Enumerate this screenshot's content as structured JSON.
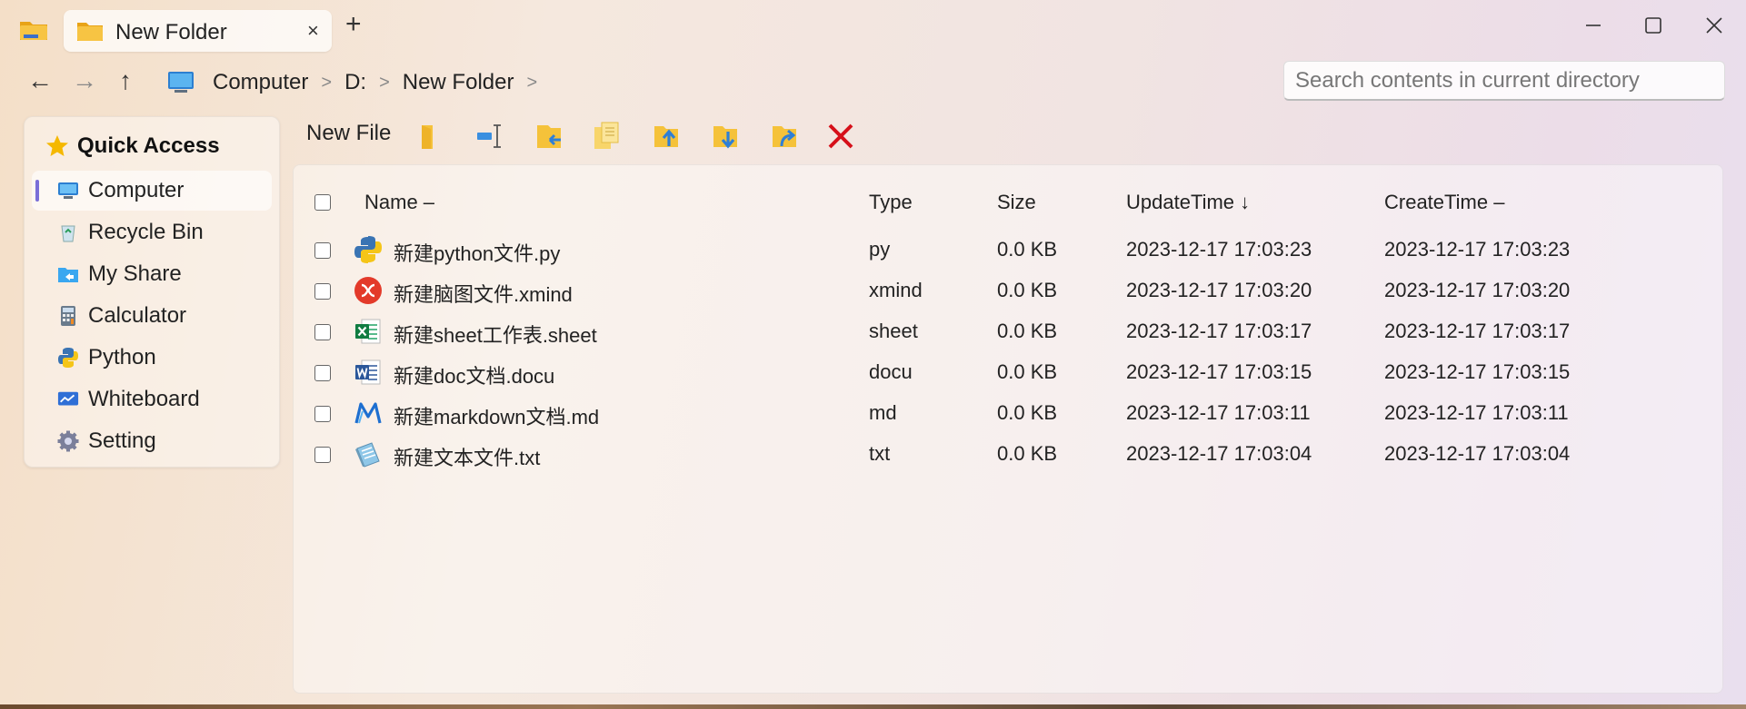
{
  "window": {
    "tab_title": "New Folder",
    "tab_close": "×",
    "new_tab": "+"
  },
  "nav": {
    "back": "←",
    "forward": "→",
    "up": "↑",
    "breadcrumb": [
      "Computer",
      "D:",
      "New Folder"
    ],
    "separator": ">"
  },
  "search": {
    "placeholder": "Search contents in current directory"
  },
  "sidebar": {
    "header": "Quick Access",
    "items": [
      {
        "label": "Computer",
        "icon": "computer-icon",
        "active": true
      },
      {
        "label": "Recycle Bin",
        "icon": "recycle-bin-icon"
      },
      {
        "label": "My Share",
        "icon": "share-icon"
      },
      {
        "label": "Calculator",
        "icon": "calculator-icon"
      },
      {
        "label": "Python",
        "icon": "python-icon"
      },
      {
        "label": "Whiteboard",
        "icon": "whiteboard-icon"
      },
      {
        "label": "Setting",
        "icon": "gear-icon"
      }
    ]
  },
  "toolbar": {
    "new_file_label": "New File",
    "tools": [
      "new-folder-icon",
      "rename-icon",
      "paste-icon",
      "copy-icon",
      "move-up-icon",
      "move-down-icon",
      "share-out-icon",
      "delete-icon"
    ]
  },
  "table": {
    "columns": {
      "name": "Name –",
      "type": "Type",
      "size": "Size",
      "update": "UpdateTime ↓",
      "create": "CreateTime –"
    },
    "rows": [
      {
        "name": "新建python文件.py",
        "type": "py",
        "size": "0.0 KB",
        "update": "2023-12-17 17:03:23",
        "create": "2023-12-17 17:03:23",
        "icon": "python-file-icon"
      },
      {
        "name": "新建脑图文件.xmind",
        "type": "xmind",
        "size": "0.0 KB",
        "update": "2023-12-17 17:03:20",
        "create": "2023-12-17 17:03:20",
        "icon": "xmind-file-icon"
      },
      {
        "name": "新建sheet工作表.sheet",
        "type": "sheet",
        "size": "0.0 KB",
        "update": "2023-12-17 17:03:17",
        "create": "2023-12-17 17:03:17",
        "icon": "excel-file-icon"
      },
      {
        "name": "新建doc文档.docu",
        "type": "docu",
        "size": "0.0 KB",
        "update": "2023-12-17 17:03:15",
        "create": "2023-12-17 17:03:15",
        "icon": "word-file-icon"
      },
      {
        "name": "新建markdown文档.md",
        "type": "md",
        "size": "0.0 KB",
        "update": "2023-12-17 17:03:11",
        "create": "2023-12-17 17:03:11",
        "icon": "markdown-file-icon"
      },
      {
        "name": "新建文本文件.txt",
        "type": "txt",
        "size": "0.0 KB",
        "update": "2023-12-17 17:03:04",
        "create": "2023-12-17 17:03:04",
        "icon": "text-file-icon"
      }
    ]
  }
}
